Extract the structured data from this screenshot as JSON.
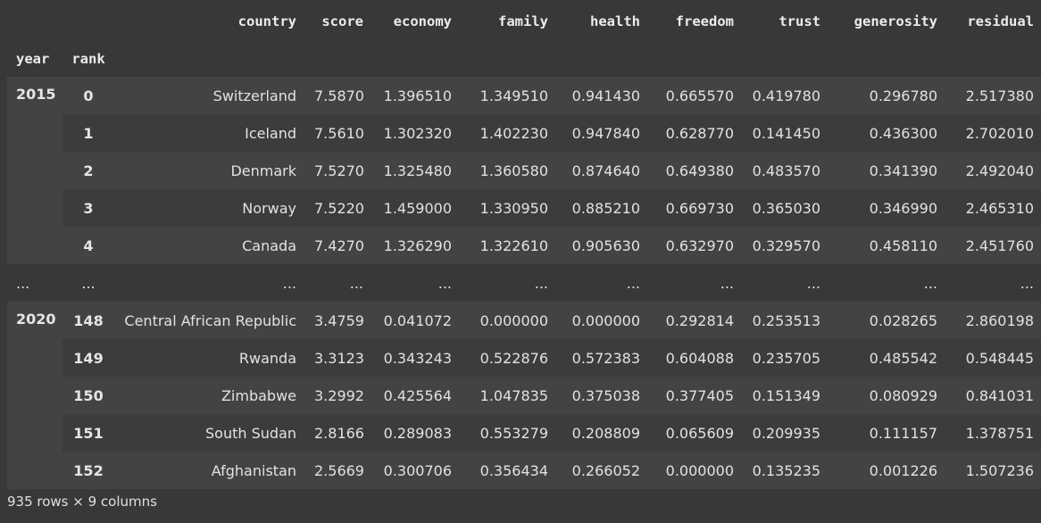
{
  "table": {
    "columns": [
      "country",
      "score",
      "economy",
      "family",
      "health",
      "freedom",
      "trust",
      "generosity",
      "residual"
    ],
    "index_names": [
      "year",
      "rank"
    ],
    "ellipsis": "...",
    "group1": {
      "year": "2015",
      "rows": [
        {
          "rank": "0",
          "cells": [
            "Switzerland",
            "7.5870",
            "1.396510",
            "1.349510",
            "0.941430",
            "0.665570",
            "0.419780",
            "0.296780",
            "2.517380"
          ]
        },
        {
          "rank": "1",
          "cells": [
            "Iceland",
            "7.5610",
            "1.302320",
            "1.402230",
            "0.947840",
            "0.628770",
            "0.141450",
            "0.436300",
            "2.702010"
          ]
        },
        {
          "rank": "2",
          "cells": [
            "Denmark",
            "7.5270",
            "1.325480",
            "1.360580",
            "0.874640",
            "0.649380",
            "0.483570",
            "0.341390",
            "2.492040"
          ]
        },
        {
          "rank": "3",
          "cells": [
            "Norway",
            "7.5220",
            "1.459000",
            "1.330950",
            "0.885210",
            "0.669730",
            "0.365030",
            "0.346990",
            "2.465310"
          ]
        },
        {
          "rank": "4",
          "cells": [
            "Canada",
            "7.4270",
            "1.326290",
            "1.322610",
            "0.905630",
            "0.632970",
            "0.329570",
            "0.458110",
            "2.451760"
          ]
        }
      ]
    },
    "group2": {
      "year": "2020",
      "rows": [
        {
          "rank": "148",
          "cells": [
            "Central African Republic",
            "3.4759",
            "0.041072",
            "0.000000",
            "0.000000",
            "0.292814",
            "0.253513",
            "0.028265",
            "2.860198"
          ]
        },
        {
          "rank": "149",
          "cells": [
            "Rwanda",
            "3.3123",
            "0.343243",
            "0.522876",
            "0.572383",
            "0.604088",
            "0.235705",
            "0.485542",
            "0.548445"
          ]
        },
        {
          "rank": "150",
          "cells": [
            "Zimbabwe",
            "3.2992",
            "0.425564",
            "1.047835",
            "0.375038",
            "0.377405",
            "0.151349",
            "0.080929",
            "0.841031"
          ]
        },
        {
          "rank": "151",
          "cells": [
            "South Sudan",
            "2.8166",
            "0.289083",
            "0.553279",
            "0.208809",
            "0.065609",
            "0.209935",
            "0.111157",
            "1.378751"
          ]
        },
        {
          "rank": "152",
          "cells": [
            "Afghanistan",
            "2.5669",
            "0.300706",
            "0.356434",
            "0.266052",
            "0.000000",
            "0.135235",
            "0.001226",
            "1.507236"
          ]
        }
      ]
    }
  },
  "footer": "935 rows × 9 columns"
}
